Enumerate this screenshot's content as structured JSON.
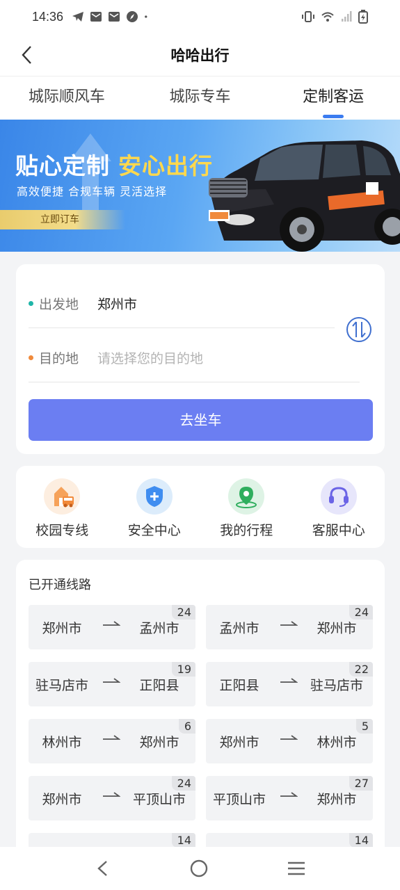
{
  "status_bar": {
    "time": "14:36"
  },
  "nav": {
    "title": "哈哈出行"
  },
  "tabs": [
    {
      "label": "城际顺风车",
      "active": false
    },
    {
      "label": "城际专车",
      "active": false
    },
    {
      "label": "定制客运",
      "active": true
    }
  ],
  "banner": {
    "headline_white": "贴心定制",
    "headline_yellow": "安心出行",
    "subline": "高效便捷  合规车辆  灵活选择",
    "button": "立即订车"
  },
  "form": {
    "from_label": "出发地",
    "from_value": "郑州市",
    "to_label": "目的地",
    "to_placeholder": "请选择您的目的地",
    "submit": "去坐车"
  },
  "menu": [
    {
      "label": "校园专线",
      "icon": "school-bus-icon"
    },
    {
      "label": "安全中心",
      "icon": "shield-plus-icon"
    },
    {
      "label": "我的行程",
      "icon": "location-pin-icon"
    },
    {
      "label": "客服中心",
      "icon": "headset-icon"
    }
  ],
  "routes": {
    "title": "已开通线路",
    "items": [
      {
        "from": "郑州市",
        "to": "孟州市",
        "count": "24"
      },
      {
        "from": "孟州市",
        "to": "郑州市",
        "count": "24"
      },
      {
        "from": "驻马店市",
        "to": "正阳县",
        "count": "19"
      },
      {
        "from": "正阳县",
        "to": "驻马店市",
        "count": "22"
      },
      {
        "from": "林州市",
        "to": "郑州市",
        "count": "6"
      },
      {
        "from": "郑州市",
        "to": "林州市",
        "count": "5"
      },
      {
        "from": "郑州市",
        "to": "平顶山市",
        "count": "24"
      },
      {
        "from": "平顶山市",
        "to": "郑州市",
        "count": "27"
      },
      {
        "from": "",
        "to": "",
        "count": "14"
      },
      {
        "from": "",
        "to": "",
        "count": "14"
      }
    ]
  },
  "colors": {
    "primary": "#6b7ef2",
    "tab_indicator": "#3b7cf0",
    "from_dot": "#1fb5a8",
    "to_dot": "#f08a3c",
    "banner_yellow": "#ffd84d"
  }
}
